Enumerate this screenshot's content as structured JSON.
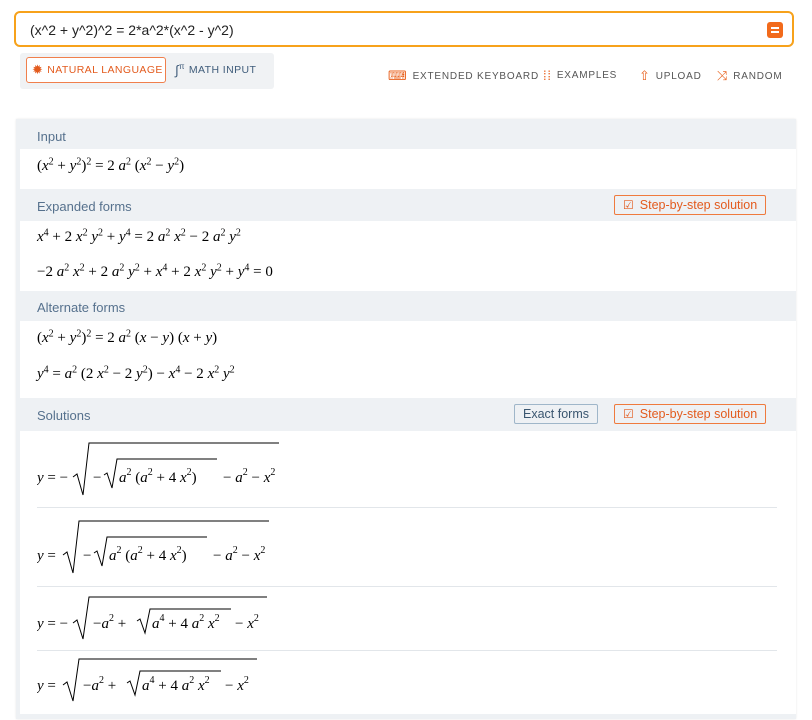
{
  "search": {
    "query": "(x^2 + y^2)^2 = 2*a^2*(x^2 - y^2)"
  },
  "modes": {
    "natural_language": "NATURAL LANGUAGE",
    "math_input": "MATH INPUT"
  },
  "top_links": {
    "extended_keyboard": "EXTENDED KEYBOARD",
    "examples": "EXAMPLES",
    "upload": "UPLOAD",
    "random": "RANDOM"
  },
  "pods": {
    "input": {
      "title": "Input"
    },
    "expanded": {
      "title": "Expanded forms",
      "step_button": "Step-by-step solution"
    },
    "alternate": {
      "title": "Alternate forms"
    },
    "solutions": {
      "title": "Solutions",
      "exact_button": "Exact forms",
      "step_button": "Step-by-step solution"
    }
  },
  "colors": {
    "accent": "#f26a1b",
    "pod_title": "#56718d",
    "search_border": "#f7a21b"
  }
}
